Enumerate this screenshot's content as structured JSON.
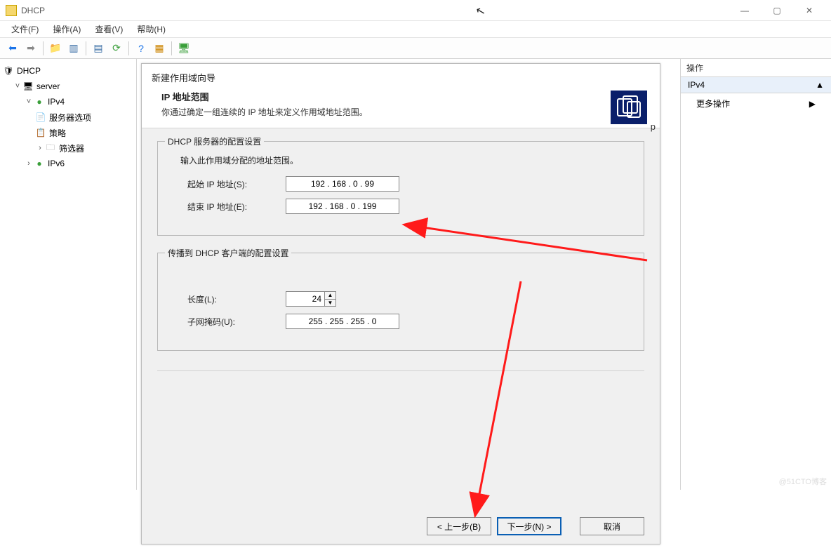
{
  "titlebar": {
    "title": "DHCP"
  },
  "menubar": {
    "file": "文件(F)",
    "action": "操作(A)",
    "view": "查看(V)",
    "help": "帮助(H)"
  },
  "tree": {
    "root": "DHCP",
    "server": "server",
    "ipv4": "IPv4",
    "serverOptions": "服务器选项",
    "policy": "策略",
    "filter": "筛选器",
    "ipv6": "IPv6"
  },
  "wizard": {
    "title": "新建作用域向导",
    "subtitle": "IP 地址范围",
    "subdesc": "你通过确定一组连续的 IP 地址来定义作用域地址范围。",
    "group1": {
      "legend": "DHCP 服务器的配置设置",
      "desc": "输入此作用域分配的地址范围。",
      "startLabel": "起始 IP 地址(S):",
      "startValue": "192 . 168 .   0  .  99",
      "endLabel": "结束 IP 地址(E):",
      "endValue": "192 . 168 .   0  . 199"
    },
    "group2": {
      "legend": "传播到 DHCP 客户端的配置设置",
      "lengthLabel": "长度(L):",
      "lengthValue": "24",
      "maskLabel": "子网掩码(U):",
      "maskValue": "255 . 255 . 255 .   0"
    },
    "buttons": {
      "back": "< 上一步(B)",
      "next": "下一步(N) >",
      "cancel": "取消"
    },
    "corner": "p"
  },
  "actions": {
    "header": "操作",
    "selected": "IPv4",
    "more": "更多操作"
  },
  "watermark": "@51CTO博客"
}
